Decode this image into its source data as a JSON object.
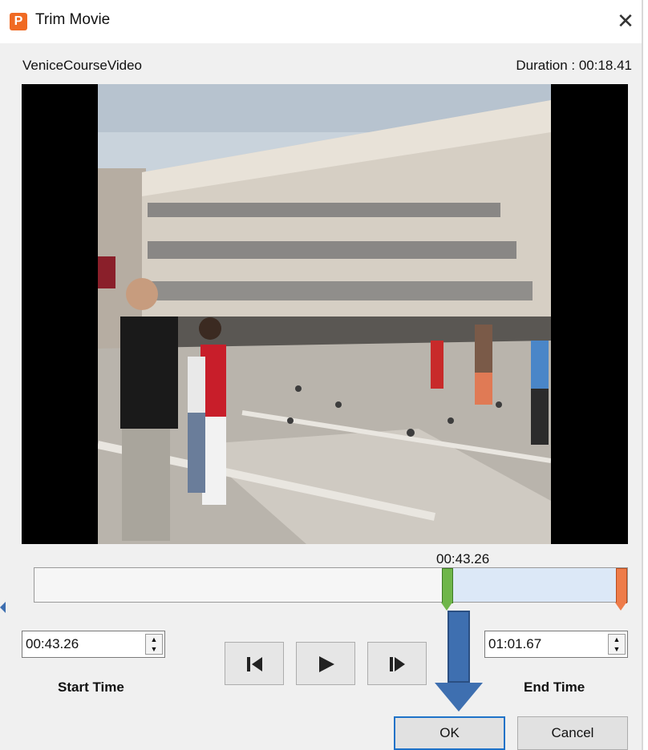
{
  "window": {
    "title": "Trim Movie",
    "close_glyph": "✕"
  },
  "app_icon": {
    "letter": "P",
    "color": "#f06a23"
  },
  "video": {
    "name": "VeniceCourseVideo",
    "duration_label": "Duration : 00:18.41"
  },
  "timeline": {
    "position_label": "00:43.26",
    "selection_start": 0.688,
    "selection_end": 1.0
  },
  "start": {
    "value": "00:43.26",
    "label": "Start Time"
  },
  "end": {
    "value": "01:01.67",
    "label": "End Time"
  },
  "buttons": {
    "ok": "OK",
    "cancel": "Cancel"
  },
  "icons": {
    "prev_frame": "step-back-icon",
    "play": "play-icon",
    "next_frame": "step-forward-icon",
    "spin_up": "▲",
    "spin_down": "▼"
  },
  "colors": {
    "selection": "#dce8f7",
    "start_handle": "#6fb64a",
    "end_handle": "#ee7c4a",
    "arrow": "#3e6fb0",
    "ok_border": "#1e72c8"
  }
}
